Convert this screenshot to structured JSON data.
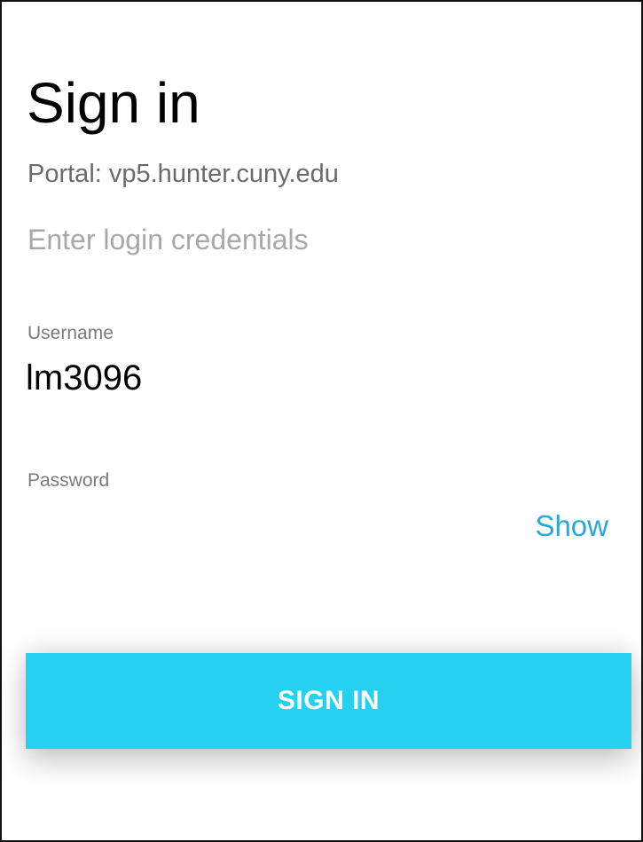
{
  "page": {
    "title": "Sign in",
    "portal": "Portal: vp5.hunter.cuny.edu",
    "subtitle": "Enter login credentials"
  },
  "username": {
    "label": "Username",
    "value": "lm3096"
  },
  "password": {
    "label": "Password",
    "value": "",
    "show_label": "Show"
  },
  "actions": {
    "signin_label": "SIGN IN"
  },
  "colors": {
    "accent": "#26d0f0",
    "link": "#2aa9d6",
    "muted_text": "#6b6b6b",
    "placeholder_text": "#a8a8a8"
  }
}
